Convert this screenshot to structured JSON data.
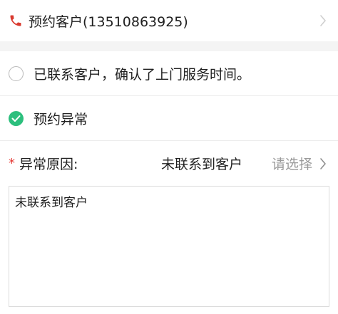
{
  "contact": {
    "label": "预约客户(13510863925)",
    "phone_icon": "phone-icon",
    "chevron_icon": "chevron-right-icon"
  },
  "options": [
    {
      "label": "已联系客户，确认了上门服务时间。",
      "selected": false
    },
    {
      "label": "预约异常",
      "selected": true
    }
  ],
  "reason": {
    "required_mark": "*",
    "label": "异常原因:",
    "value": "未联系到客户",
    "placeholder": "请选择"
  },
  "note": {
    "text": "未联系到客户"
  },
  "colors": {
    "accent_green": "#2cbf7d",
    "phone_red": "#d93a2f",
    "required_red": "#e53935"
  }
}
